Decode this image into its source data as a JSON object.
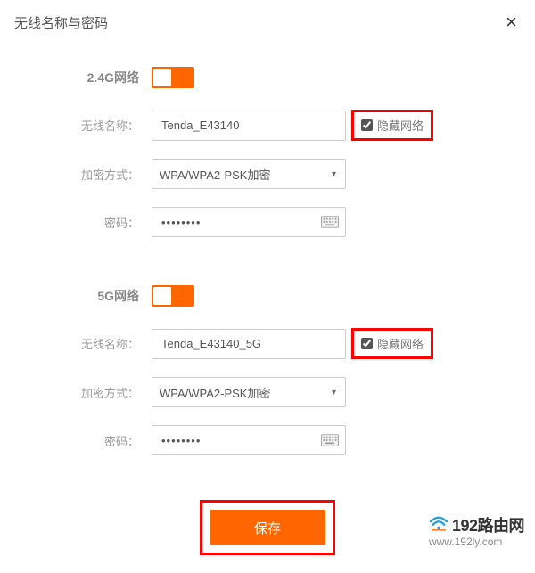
{
  "dialog": {
    "title": "无线名称与密码"
  },
  "sections": {
    "g24": {
      "heading": "2.4G网络",
      "ssid_label": "无线名称：",
      "ssid_value": "Tenda_E43140",
      "hide_label": "隐藏网络",
      "hide_checked": true,
      "enc_label": "加密方式：",
      "enc_value": "WPA/WPA2-PSK加密",
      "pwd_label": "密码：",
      "pwd_value": "••••••••"
    },
    "g5": {
      "heading": "5G网络",
      "ssid_label": "无线名称：",
      "ssid_value": "Tenda_E43140_5G",
      "hide_label": "隐藏网络",
      "hide_checked": true,
      "enc_label": "加密方式：",
      "enc_value": "WPA/WPA2-PSK加密",
      "pwd_label": "密码：",
      "pwd_value": "••••••••"
    }
  },
  "footer": {
    "save_label": "保存"
  },
  "watermark": {
    "title": "192路由网",
    "sub": "www.192ly.com"
  }
}
